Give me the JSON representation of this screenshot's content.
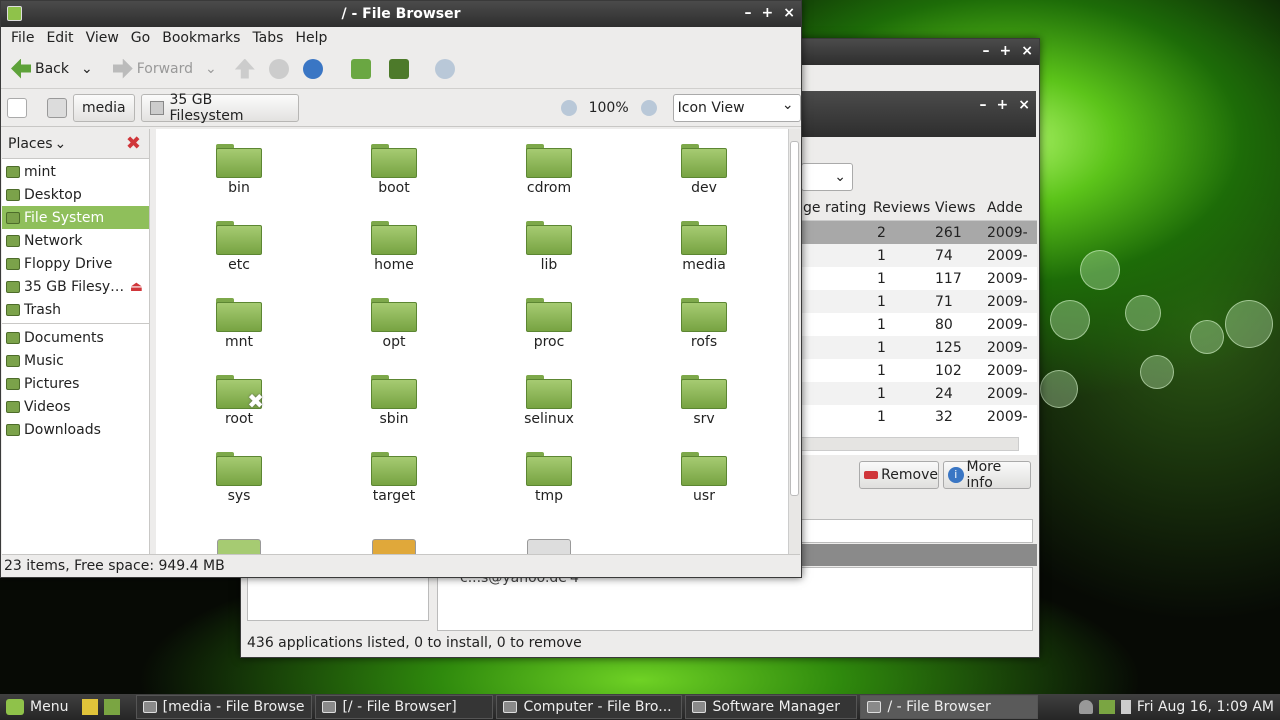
{
  "file_browser": {
    "title": "/ - File Browser",
    "menu": [
      "File",
      "Edit",
      "View",
      "Go",
      "Bookmarks",
      "Tabs",
      "Help"
    ],
    "toolbar": {
      "back": "Back",
      "forward": "Forward"
    },
    "location": {
      "path": [
        "media",
        "35 GB Filesystem"
      ],
      "zoom": "100%",
      "view_mode": "Icon View"
    },
    "places_label": "Places",
    "places": [
      {
        "label": "mint",
        "icon": "home-folder-icon"
      },
      {
        "label": "Desktop",
        "icon": "desktop-icon"
      },
      {
        "label": "File System",
        "icon": "drive-icon",
        "selected": true
      },
      {
        "label": "Network",
        "icon": "network-icon"
      },
      {
        "label": "Floppy Drive",
        "icon": "floppy-icon"
      },
      {
        "label": "35 GB Filesy…",
        "icon": "drive-icon"
      },
      {
        "label": "Trash",
        "icon": "trash-icon"
      }
    ],
    "bookmarks": [
      "Documents",
      "Music",
      "Pictures",
      "Videos",
      "Downloads"
    ],
    "folders": [
      "bin",
      "boot",
      "cdrom",
      "dev",
      "etc",
      "home",
      "lib",
      "media",
      "mnt",
      "opt",
      "proc",
      "rofs",
      "root",
      "sbin",
      "selinux",
      "srv",
      "sys",
      "target",
      "tmp",
      "usr"
    ],
    "status": "23 items, Free space: 949.4 MB"
  },
  "software_manager": {
    "columns": [
      "ge rating",
      "Reviews",
      "Views",
      "Adde"
    ],
    "rows": [
      {
        "reviews": "2",
        "views": "261",
        "added": "2009-"
      },
      {
        "reviews": "1",
        "views": "74",
        "added": "2009-"
      },
      {
        "reviews": "1",
        "views": "117",
        "added": "2009-"
      },
      {
        "reviews": "1",
        "views": "71",
        "added": "2009-"
      },
      {
        "reviews": "1",
        "views": "80",
        "added": "2009-"
      },
      {
        "reviews": "1",
        "views": "125",
        "added": "2009-"
      },
      {
        "reviews": "1",
        "views": "102",
        "added": "2009-"
      },
      {
        "reviews": "1",
        "views": "24",
        "added": "2009-"
      },
      {
        "reviews": "1",
        "views": "32",
        "added": "2009-"
      }
    ],
    "remove_label": "Remove",
    "more_info_label": "More info",
    "review_snippet": "c...s@yahoo.de",
    "review_snippet_val": "4",
    "status": "436 applications listed, 0 to install, 0 to remove"
  },
  "taskbar": {
    "menu": "Menu",
    "tasks": [
      "[media - File Browser]",
      "[/ - File Browser]",
      "Computer - File Bro...",
      "Software Manager",
      "/ - File Browser"
    ],
    "clock": "Fri Aug 16,  1:09 AM"
  }
}
